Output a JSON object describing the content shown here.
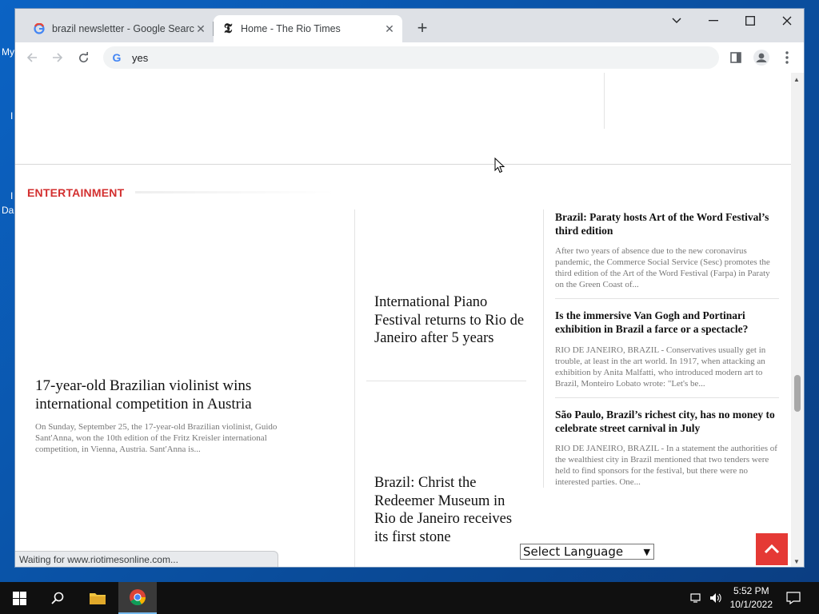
{
  "desktop": {
    "labels": [
      "My",
      "I",
      "I",
      "Da"
    ]
  },
  "browser": {
    "tabs": [
      {
        "title": "brazil newsletter - Google Search",
        "active": false
      },
      {
        "title": "Home - The Rio Times",
        "active": true
      }
    ],
    "omnibox_value": "yes",
    "status_text": "Waiting for www.riotimesonline.com..."
  },
  "page": {
    "section_title": "ENTERTAINMENT",
    "left_article": {
      "headline": "17-year-old Brazilian violinist wins international competition in Austria",
      "excerpt": "On Sunday, September 25, the 17-year-old Brazilian violinist, Guido Sant'Anna, won the 10th edition of the Fritz Kreisler international competition, in Vienna, Austria. Sant'Anna is..."
    },
    "middle_articles": [
      {
        "headline": "International Piano Festival returns to Rio de Janeiro after 5 years"
      },
      {
        "headline": "Brazil: Christ the Redeemer Museum in Rio de Janeiro receives its first stone"
      }
    ],
    "right_articles": [
      {
        "headline": "Brazil: Paraty hosts Art of the Word Festival’s third edition",
        "excerpt": "After two years of absence due to the new coronavirus pandemic, the Commerce Social Service (Sesc) promotes the third edition of the Art of the Word Festival (Farpa) in Paraty on the Green Coast of..."
      },
      {
        "headline": "Is the immersive Van Gogh and Portinari exhibition in Brazil a farce or a spectacle?",
        "excerpt": "RIO DE JANEIRO, BRAZIL - Conservatives usually get in trouble, at least in the art world. In 1917, when attacking an exhibition by Anita Malfatti, who introduced modern art to Brazil, Monteiro Lobato wrote: \"Let's be..."
      },
      {
        "headline": "São Paulo, Brazil’s richest city, has no money to celebrate street carnival in July",
        "excerpt": "RIO DE JANEIRO, BRAZIL - In a statement the authorities of the wealthiest city in Brazil mentioned that two tenders were held to find sponsors for the festival, but there were no interested parties. One..."
      }
    ],
    "language_select": "Select Language"
  },
  "taskbar": {
    "time": "5:52 PM",
    "date": "10/1/2022"
  },
  "colors": {
    "accent_red": "#d32f2f",
    "to_top_button": "#e53935"
  }
}
